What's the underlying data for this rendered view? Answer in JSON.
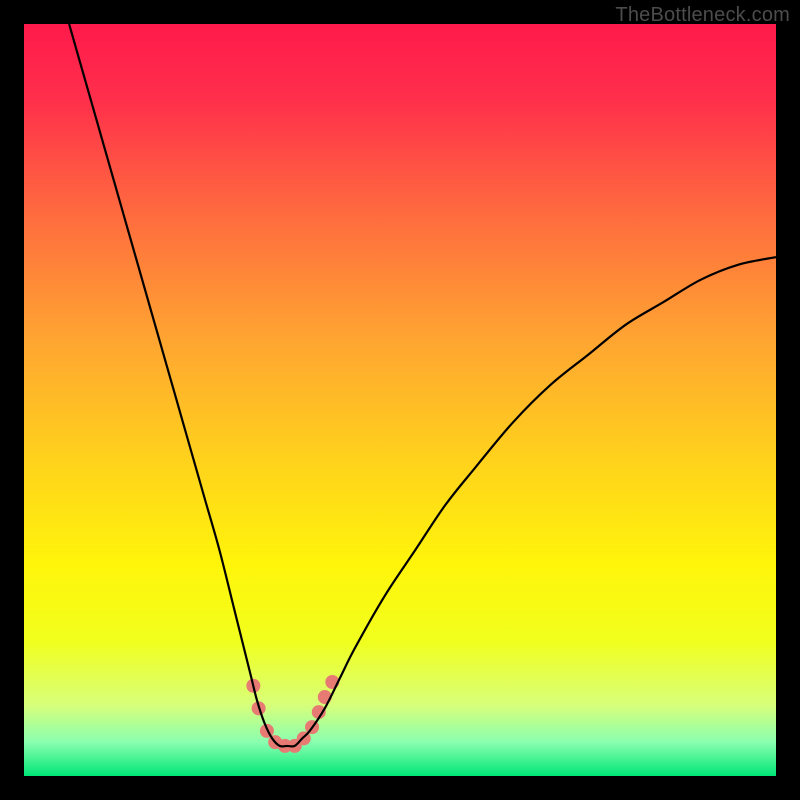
{
  "watermark": "TheBottleneck.com",
  "chart_data": {
    "type": "line",
    "title": "",
    "xlabel": "",
    "ylabel": "",
    "xlim": [
      0,
      100
    ],
    "ylim": [
      0,
      100
    ],
    "grid": false,
    "legend": false,
    "annotations": [],
    "background_gradient_stops": [
      {
        "offset": 0.0,
        "color": "#ff1a4b"
      },
      {
        "offset": 0.1,
        "color": "#ff2f4b"
      },
      {
        "offset": 0.25,
        "color": "#ff6a3f"
      },
      {
        "offset": 0.42,
        "color": "#ffa531"
      },
      {
        "offset": 0.58,
        "color": "#ffd21c"
      },
      {
        "offset": 0.72,
        "color": "#fff50a"
      },
      {
        "offset": 0.82,
        "color": "#f1ff1d"
      },
      {
        "offset": 0.905,
        "color": "#d8ff7a"
      },
      {
        "offset": 0.955,
        "color": "#8affb0"
      },
      {
        "offset": 1.0,
        "color": "#00e676"
      }
    ],
    "series": [
      {
        "name": "bottleneck-curve",
        "color": "#000000",
        "x": [
          6,
          8,
          10,
          12,
          14,
          16,
          18,
          20,
          22,
          24,
          26,
          28,
          30,
          31,
          32,
          33,
          34,
          35,
          36,
          37,
          38,
          40,
          42,
          44,
          48,
          52,
          56,
          60,
          65,
          70,
          75,
          80,
          85,
          90,
          95,
          100
        ],
        "y": [
          100,
          93,
          86,
          79,
          72,
          65,
          58,
          51,
          44,
          37,
          30,
          22,
          14,
          10,
          7,
          5,
          4,
          4,
          4,
          5,
          6,
          9,
          13,
          17,
          24,
          30,
          36,
          41,
          47,
          52,
          56,
          60,
          63,
          66,
          68,
          69
        ]
      }
    ],
    "markers": {
      "name": "highlight-points",
      "color": "#e77a73",
      "radius_px": 7,
      "points": [
        {
          "x": 30.5,
          "y": 12
        },
        {
          "x": 31.2,
          "y": 9
        },
        {
          "x": 32.3,
          "y": 6
        },
        {
          "x": 33.4,
          "y": 4.5
        },
        {
          "x": 34.7,
          "y": 4
        },
        {
          "x": 36.0,
          "y": 4
        },
        {
          "x": 37.2,
          "y": 5
        },
        {
          "x": 38.3,
          "y": 6.5
        },
        {
          "x": 39.2,
          "y": 8.5
        },
        {
          "x": 40.0,
          "y": 10.5
        },
        {
          "x": 41.0,
          "y": 12.5
        }
      ]
    }
  }
}
